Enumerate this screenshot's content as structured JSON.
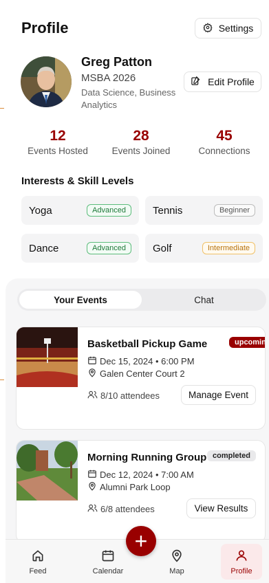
{
  "header": {
    "title": "Profile",
    "settings_label": "Settings"
  },
  "user": {
    "name": "Greg Patton",
    "program": "MSBA 2026",
    "focus": "Data Science, Business Analytics",
    "edit_label": "Edit Profile"
  },
  "stats": [
    {
      "value": "12",
      "label": "Events Hosted"
    },
    {
      "value": "28",
      "label": "Events Joined"
    },
    {
      "value": "45",
      "label": "Connections"
    }
  ],
  "interests": {
    "title": "Interests & Skill Levels",
    "items": [
      {
        "name": "Yoga",
        "level": "Advanced"
      },
      {
        "name": "Tennis",
        "level": "Beginner"
      },
      {
        "name": "Dance",
        "level": "Advanced"
      },
      {
        "name": "Golf",
        "level": "Intermediate"
      }
    ]
  },
  "tabs": {
    "active": "Your Events",
    "other": "Chat"
  },
  "events": [
    {
      "title": "Basketball Pickup Game",
      "status": "upcoming",
      "datetime": "Dec 15, 2024 • 6:00 PM",
      "location": "Galen Center Court 2",
      "attendees": "8/10 attendees",
      "action": "Manage Event"
    },
    {
      "title": "Morning Running Group",
      "status": "completed",
      "datetime": "Dec 12, 2024 • 7:00 AM",
      "location": "Alumni Park Loop",
      "attendees": "6/8 attendees",
      "action": "View Results"
    }
  ],
  "fab_label": "+",
  "nav": [
    {
      "label": "Feed",
      "icon": "home-icon"
    },
    {
      "label": "Calendar",
      "icon": "calendar-icon"
    },
    {
      "label": "Map",
      "icon": "map-pin-icon"
    },
    {
      "label": "Profile",
      "icon": "user-icon"
    }
  ],
  "colors": {
    "brand": "#990000",
    "advanced": "#1f7a3a",
    "intermediate": "#b8730e"
  }
}
